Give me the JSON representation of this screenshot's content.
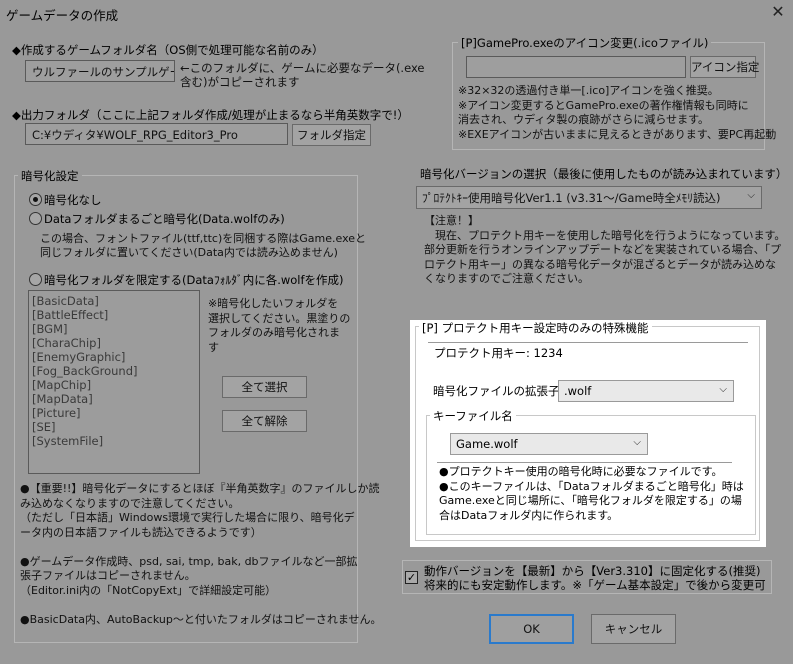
{
  "window": {
    "title": "ゲームデータの作成",
    "close_label": "✕"
  },
  "folder_name": {
    "label": "◆作成するゲームフォルダ名（OS側で処理可能な名前のみ）",
    "value": "ウルファールのサンプルゲーム",
    "note": "←このフォルダに、ゲームに必要なデータ(.exe\n含む)がコピーされます"
  },
  "output": {
    "label": "◆出力フォルダ（ここに上記フォルダ作成/処理が止まるなら半角英数字で!）",
    "value": "C:¥ウディタ¥WOLF_RPG_Editor3_Pro",
    "button": "フォルダ指定"
  },
  "icon": {
    "title": "[P]GamePro.exeのアイコン変更(.icoファイル)",
    "button": "アイコン指定",
    "note": "※32×32の透過付き単一[.ico]アイコンを強く推奨。\n※アイコン変更するとGamePro.exeの著作権情報も同時に\n消去され、ウディタ製の痕跡がさらに減らせます。\n※EXEアイコンが古いままに見えるときがあります、要PC再起動"
  },
  "encrypt": {
    "title": "暗号化設定",
    "opt_none": "暗号化なし",
    "opt_whole": "Dataフォルダまるごと暗号化(Data.wolfのみ)",
    "whole_note": "この場合、フォントファイル(ttf,ttc)を同梱する際はGame.exeと\n同じフォルダに置いてください(Data内では読み込めません)",
    "opt_limited": "暗号化フォルダを限定する(Dataﾌｫﾙﾀﾞ内に各.wolfを作成)",
    "folders": [
      "[BasicData]",
      "[BattleEffect]",
      "[BGM]",
      "[CharaChip]",
      "[EnemyGraphic]",
      "[Fog_BackGround]",
      "[MapChip]",
      "[MapData]",
      "[Picture]",
      "[SE]",
      "[SystemFile]"
    ],
    "folders_note": "※暗号化したいフォルダを\n選択してください。黒塗りの\nフォルダのみ暗号化されま\nす",
    "select_all": "全て選択",
    "deselect_all": "全て解除"
  },
  "warnings": "●【重要!!】暗号化データにするとほぼ『半角英数字』のファイルしか読\nみ込めなくなりますので注意してください。\n（ただし「日本語」Windows環境で実行した場合に限り、暗号化デ\nータ内の日本語ファイルも読込できるようです）\n\n●ゲームデータ作成時、psd, sai, tmp, bak, dbファイルなど一部拡\n張子ファイルはコピーされません。\n（Editor.ini内の「NotCopyExt」で詳細設定可能）\n\n●BasicData内、AutoBackup～と付いたフォルダはコピーされません。",
  "version": {
    "title": "暗号化バージョンの選択（最後に使用したものが読み込まれています）",
    "selected": "ﾌﾟﾛﾃｸﾄｷｰ使用暗号化Ver1.1 (v3.31～/Game時全ﾒﾓﾘ読込)",
    "note": "【注意！】\n　現在、プロテクト用キーを使用した暗号化を行うようになっています。\n部分更新を行うオンラインアップデートなどを実装されている場合、「プ\nロテクト用キー」の異なる暗号化データが混ざるとデータが読み込めな\nくなりますのでご注意ください。"
  },
  "protect": {
    "title": "[P] プロテクト用キー設定時のみの特殊機能",
    "key_line": "プロテクト用キー: 1234",
    "ext_label": "暗号化ファイルの拡張子",
    "ext_value": ".wolf",
    "keyfile_title": "キーファイル名",
    "keyfile_value": "Game.wolf",
    "keyfile_note": "●プロテクトキー使用の暗号化時に必要なファイルです。\n●このキーファイルは、「Dataフォルダまるごと暗号化」時は\nGame.exeと同じ場所に、「暗号化フォルダを限定する」の場\n合はDataフォルダ内に作られます。"
  },
  "fix_version": {
    "line1": "動作バージョンを【最新】から【Ver3.310】に固定化する(推奨)",
    "line2": "将来的にも安定動作します。※「ゲーム基本設定」で後から変更可",
    "checked": true
  },
  "footer": {
    "ok": "OK",
    "cancel": "キャンセル"
  }
}
